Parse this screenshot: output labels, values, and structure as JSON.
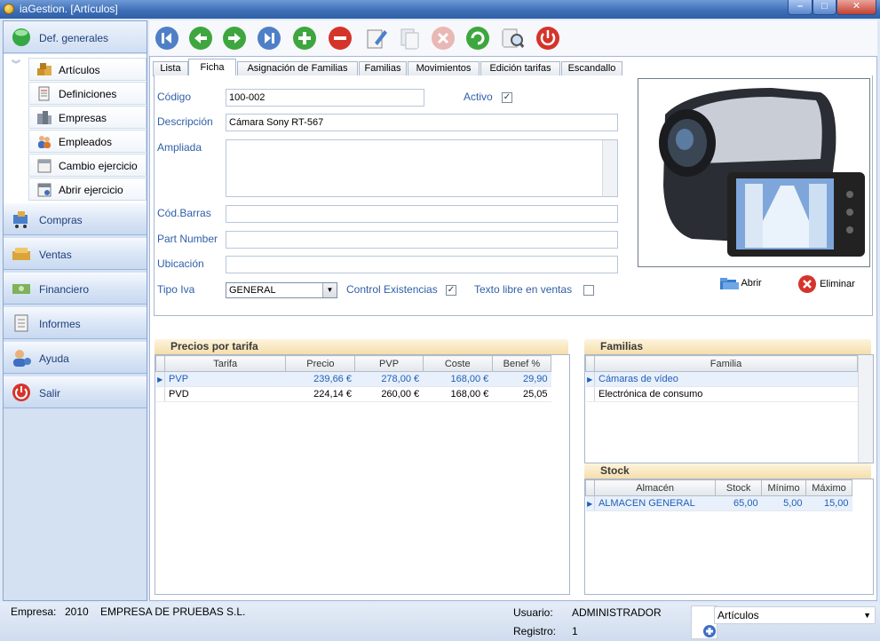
{
  "window": {
    "title": "iaGestion. [Artículos]",
    "min": "–",
    "max": "□",
    "close": "✕"
  },
  "sidebar": {
    "def_label": "Def. generales",
    "sub_items": [
      "Artículos",
      "Definiciones",
      "Empresas",
      "Empleados",
      "Cambio ejercicio",
      "Abrir ejercicio"
    ],
    "sections": [
      "Compras",
      "Ventas",
      "Financiero",
      "Informes",
      "Ayuda",
      "Salir"
    ]
  },
  "toolbar": {
    "buttons": [
      "first",
      "previous",
      "next",
      "last",
      "add",
      "delete",
      "edit",
      "copy",
      "cancel",
      "refresh",
      "search",
      "exit"
    ],
    "colors": {
      "nav": "#4f7fc7",
      "green": "#3ea63e",
      "red": "#d5342b"
    }
  },
  "tabs": [
    "Lista",
    "Ficha",
    "Asignación de Familias",
    "Familias",
    "Movimientos",
    "Edición tarifas",
    "Escandallo"
  ],
  "form": {
    "codigo_label": "Código",
    "codigo": "100-002",
    "activo_label": "Activo",
    "activo_checked": true,
    "descripcion_label": "Descripción",
    "descripcion": "Cámara Sony RT-567",
    "ampliada_label": "Ampliada",
    "codbarras_label": "Cód.Barras",
    "partnumber_label": "Part Number",
    "ubicacion_label": "Ubicación",
    "tipoiva_label": "Tipo Iva",
    "tipoiva": "GENERAL",
    "control_label": "Control Existencias",
    "control_checked": true,
    "texto_label": "Texto libre en ventas",
    "texto_checked": false,
    "abrir": "Abrir",
    "eliminar": "Eliminar"
  },
  "precios": {
    "title": "Precios por tarifa",
    "columns": [
      "Tarifa",
      "Precio",
      "PVP",
      "Coste",
      "Benef %"
    ],
    "rows": [
      [
        "PVP",
        "239,66 €",
        "278,00 €",
        "168,00 €",
        "29,90"
      ],
      [
        "PVD",
        "224,14 €",
        "260,00 €",
        "168,00 €",
        "25,05"
      ]
    ]
  },
  "familias": {
    "title": "Familias",
    "column": "Familia",
    "rows": [
      "Cámaras de vídeo",
      "Electrónica de consumo"
    ]
  },
  "stock": {
    "title": "Stock",
    "columns": [
      "Almacén",
      "Stock",
      "Mínimo",
      "Máximo"
    ],
    "rows": [
      [
        "ALMACEN GENERAL",
        "65,00",
        "5,00",
        "15,00"
      ]
    ]
  },
  "status": {
    "empresa_label": "Empresa:",
    "empresa_code": "2010",
    "empresa_name": "EMPRESA DE PRUEBAS S.L.",
    "usuario_label": "Usuario:",
    "usuario": "ADMINISTRADOR",
    "registro_label": "Registro:",
    "registro": "1",
    "module": "Artículos"
  }
}
